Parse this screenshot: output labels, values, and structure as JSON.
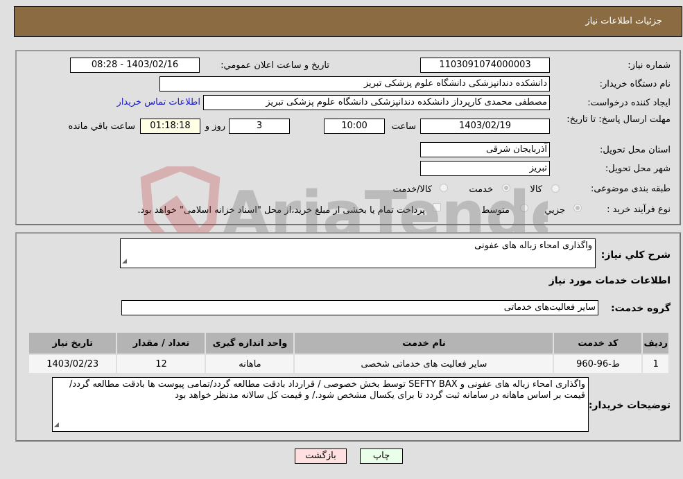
{
  "header": {
    "title": "جزئیات اطلاعات نیاز"
  },
  "form": {
    "need_number_label": "شماره نیاز:",
    "need_number": "1103091074000003",
    "announce_label": "تاریخ و ساعت اعلان عمومي:",
    "announce_value": "1403/02/16 - 08:28",
    "buyer_org_label": "نام دستگاه خریدار:",
    "buyer_org": "دانشکده دندانپزشکی دانشگاه علوم پزشکی تبریز",
    "creator_label": "ایجاد کننده درخواست:",
    "creator": "مصطفی محمدی کارپرداز دانشکده دندانپزشکی دانشگاه علوم پزشکی تبریز",
    "contact_link": "اطلاعات تماس خریدار",
    "deadline_label": "مهلت ارسال پاسخ: تا تاریخ:",
    "deadline_date": "1403/02/19",
    "time_label": "ساعت",
    "deadline_time": "10:00",
    "days_value": "3",
    "days_label": "روز و",
    "remaining_time": "01:18:18",
    "remaining_label": "ساعت باقي مانده",
    "province_label": "استان محل تحویل:",
    "province": "آذربایجان شرقی",
    "city_label": "شهر محل تحویل:",
    "city": "تبریز",
    "category_label": "طبقه بندی موضوعی:",
    "category_options": [
      "کالا",
      "خدمت",
      "کالا/خدمت"
    ],
    "category_selected": "خدمت",
    "process_label": "نوع فرآیند خرید :",
    "process_options": [
      "جزیي",
      "متوسط"
    ],
    "process_selected": "جزیي",
    "payment_note": "پرداخت تمام یا بخشی از مبلغ خرید،از محل \"اسناد خزانه اسلامی\" خواهد بود."
  },
  "details": {
    "summary_label": "شرح کلي نیاز:",
    "summary": "واگذاری امحاء زباله های عفونی",
    "services_heading": "اطلاعات خدمات مورد نیاز",
    "service_group_label": "گروه خدمت:",
    "service_group": "سایر فعالیت‌های خدماتی",
    "table": {
      "headers": [
        "ردیف",
        "کد خدمت",
        "نام خدمت",
        "واحد اندازه گیری",
        "تعداد / مقدار",
        "تاریخ نیاز"
      ],
      "rows": [
        [
          "1",
          "ط-96-960",
          "سایر فعالیت های خدماتی شخصی",
          "ماهانه",
          "12",
          "1403/02/23"
        ]
      ]
    },
    "buyer_notes_label": "توضیحات خریدار:",
    "buyer_notes": "واگذاری امحاء زباله های عفونی و SEFTY BAX  توسط بخش خصوصی / قرارداد بادقت مطالعه گردد/تمامی پیوست ها بادقت مطالعه گردد/ قیمت بر اساس ماهانه در سامانه ثبت گردد تا برای یکسال مشخص شود./ و قیمت کل سالانه مدنظر خواهد بود"
  },
  "buttons": {
    "print": "چاپ",
    "back": "بازگشت"
  },
  "watermark": "AriaTender.neT"
}
